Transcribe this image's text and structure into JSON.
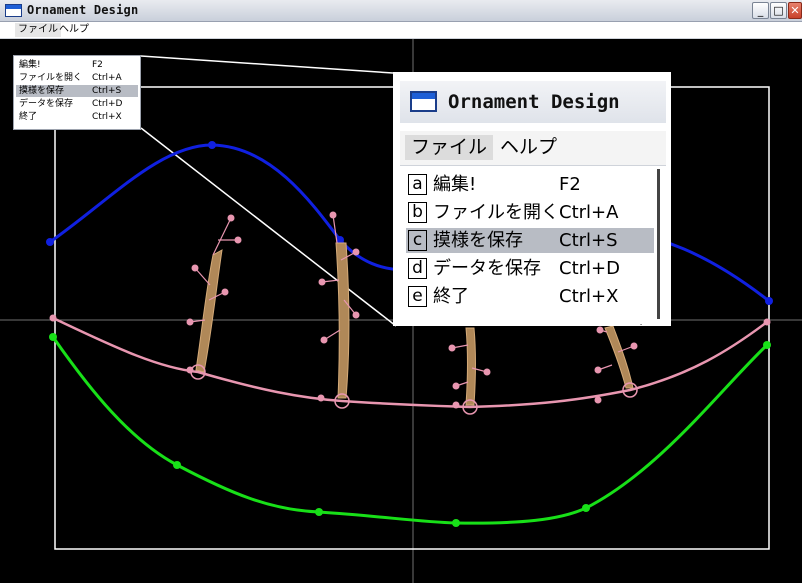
{
  "window": {
    "title": "Ornament Design",
    "min_glyph": "_",
    "max_glyph": "□",
    "close_glyph": "✕"
  },
  "menubar": {
    "items": [
      {
        "label": "ファイル"
      },
      {
        "label": "ヘルプ"
      }
    ]
  },
  "file_menu": {
    "items": [
      {
        "letter": "a",
        "label": "編集!",
        "shortcut": "F2"
      },
      {
        "letter": "b",
        "label": "ファイルを開く",
        "shortcut": "Ctrl+A"
      },
      {
        "letter": "c",
        "label": "摸様を保存",
        "shortcut": "Ctrl+S",
        "highlighted": true
      },
      {
        "letter": "d",
        "label": "データを保存",
        "shortcut": "Ctrl+D"
      },
      {
        "letter": "e",
        "label": "終了",
        "shortcut": "Ctrl+X"
      }
    ]
  },
  "colors": {
    "background": "#000000",
    "blue_curve": "#1020e0",
    "pink_curve": "#e896b0",
    "green_curve": "#18e018",
    "crosshair": "#707070",
    "frame": "#ffffff",
    "branch": "#b08858",
    "menu_highlight": "#b8bcc4"
  },
  "icons": {
    "app": "window-icon",
    "cursor": "arrow-cursor-icon"
  }
}
